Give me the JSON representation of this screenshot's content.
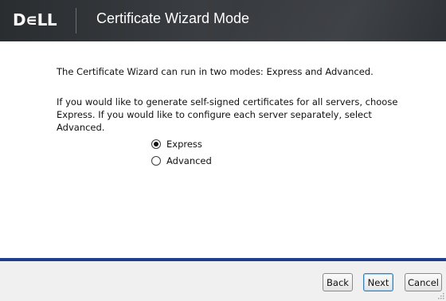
{
  "header": {
    "logo_text": "D∊LL",
    "title": "Certificate Wizard Mode"
  },
  "content": {
    "intro": "The Certificate Wizard can run in two modes: Express and Advanced.",
    "explanation": "If you would like to generate self-signed certificates for all servers, choose Express. If you would like to configure each server separately, select Advanced.",
    "modes": [
      {
        "label": "Express",
        "selected": true
      },
      {
        "label": "Advanced",
        "selected": false
      }
    ]
  },
  "footer": {
    "back_label": "Back",
    "next_label": "Next",
    "cancel_label": "Cancel"
  },
  "colors": {
    "header_bg": "#34373b",
    "accent_rule": "#1f3f8c",
    "footer_bg": "#f0f0f0"
  }
}
